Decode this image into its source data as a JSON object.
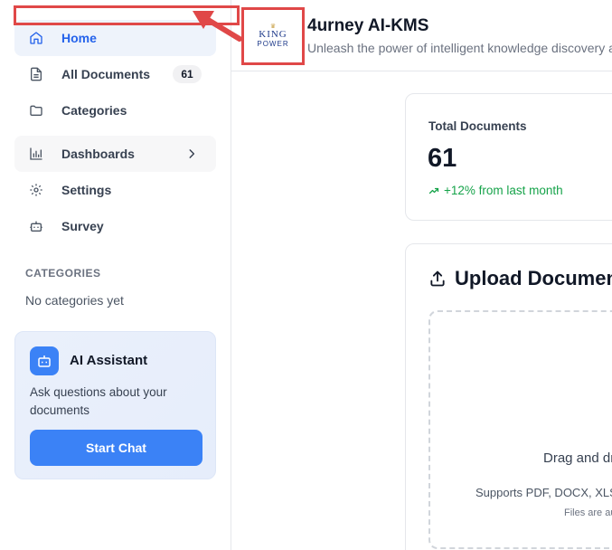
{
  "sidebar": {
    "nav": [
      {
        "label": "Home",
        "icon": "home-icon",
        "active": true
      },
      {
        "label": "All Documents",
        "icon": "file-icon",
        "badge": "61"
      },
      {
        "label": "Categories",
        "icon": "folder-icon"
      },
      {
        "label": "Dashboards",
        "icon": "bar-chart-icon",
        "has_submenu": true
      },
      {
        "label": "Settings",
        "icon": "gear-icon"
      },
      {
        "label": "Survey",
        "icon": "bot-icon"
      }
    ],
    "categories_heading": "CATEGORIES",
    "categories_empty": "No categories yet",
    "ai_card": {
      "title": "AI Assistant",
      "description": "Ask questions about your documents",
      "button": "Start Chat"
    }
  },
  "header": {
    "logo_line1": "KING",
    "logo_line2": "POWER",
    "title": "4urney AI-KMS",
    "subtitle": "Unleash the power of intelligent knowledge discovery and"
  },
  "stats": {
    "label": "Total Documents",
    "value": "61",
    "trend": "+12% from last month"
  },
  "upload": {
    "title": "Upload Documents",
    "drop_text": "Drag and drop",
    "supports": "Supports PDF, DOCX, XLSX",
    "note": "Files are automatically"
  },
  "colors": {
    "accent": "#3b82f6",
    "annotation": "#e04848",
    "trend": "#16a34a"
  }
}
